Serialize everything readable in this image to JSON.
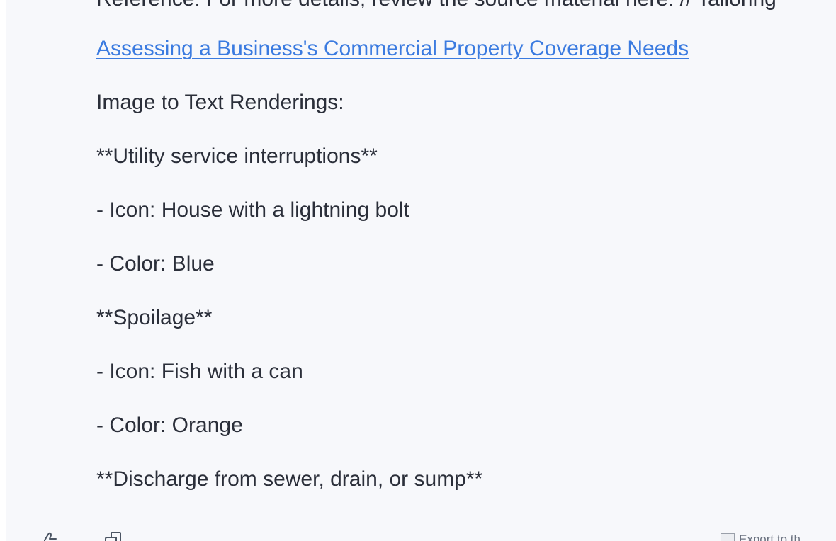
{
  "message": {
    "reference_text": "Reference: For more details, review the source material here: // Tailoring",
    "link_text": "Assessing a Business's Commercial Property Coverage Needs",
    "lines": [
      "Image to Text Renderings:",
      "**Utility service interruptions**",
      "- Icon: House with a lightning bolt",
      "- Color: Blue",
      "**Spoilage**",
      "- Icon: Fish with a can",
      "- Color: Orange",
      "**Discharge from sewer, drain, or sump**"
    ]
  },
  "footer": {
    "export_label": "Export to th",
    "icons": [
      "thumbs-up-icon",
      "copy-icon",
      "export-doc-icon"
    ]
  }
}
